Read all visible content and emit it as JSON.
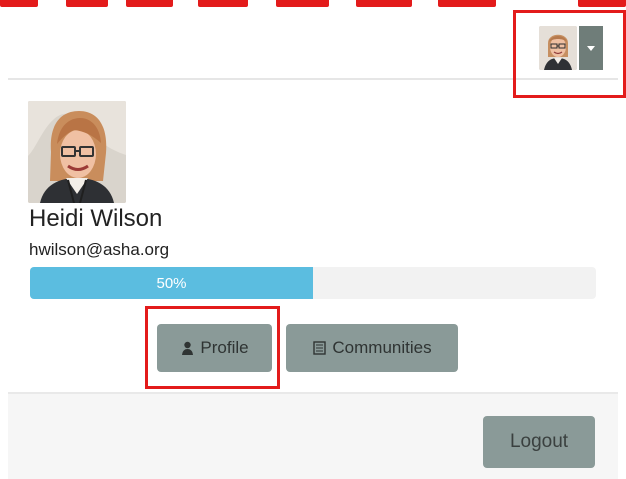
{
  "header": {
    "menu_avatar_alt": "user avatar",
    "menu_caret_icon": "caret-down-icon"
  },
  "profile": {
    "name": "Heidi Wilson",
    "email": "hwilson@asha.org",
    "progress_percent": 50,
    "progress_label": "50%",
    "avatar_icon": "user-photo"
  },
  "actions": {
    "profile_label": "Profile",
    "profile_icon": "user-icon",
    "communities_label": "Communities",
    "communities_icon": "list-icon",
    "logout_label": "Logout"
  },
  "colors": {
    "annotation_red": "#e31b1b",
    "progress_fill": "#5bbde0",
    "button_gray": "#8a9a98",
    "footer_bg": "#f6f6f6"
  }
}
